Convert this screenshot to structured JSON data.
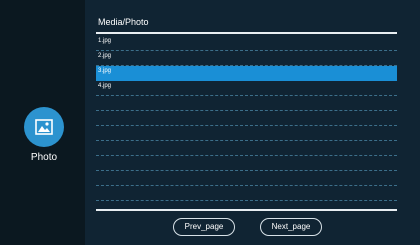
{
  "sidebar": {
    "app_icon": "photo-icon",
    "app_label": "Photo"
  },
  "main": {
    "title": "Media/Photo",
    "files": [
      {
        "name": "1.jpg",
        "selected": false
      },
      {
        "name": "2.jpg",
        "selected": false
      },
      {
        "name": "3.jpg",
        "selected": true
      },
      {
        "name": "4.jpg",
        "selected": false
      },
      {
        "name": "",
        "selected": false
      },
      {
        "name": "",
        "selected": false
      },
      {
        "name": "",
        "selected": false
      },
      {
        "name": "",
        "selected": false
      },
      {
        "name": "",
        "selected": false
      },
      {
        "name": "",
        "selected": false
      },
      {
        "name": "",
        "selected": false
      }
    ]
  },
  "pagination": {
    "prev_label": "Prev_page",
    "next_label": "Next_page"
  },
  "colors": {
    "accent": "#1a8fd6",
    "icon_circle": "#2c93cf",
    "background": "#102433",
    "sidebar": "#0b1820"
  }
}
